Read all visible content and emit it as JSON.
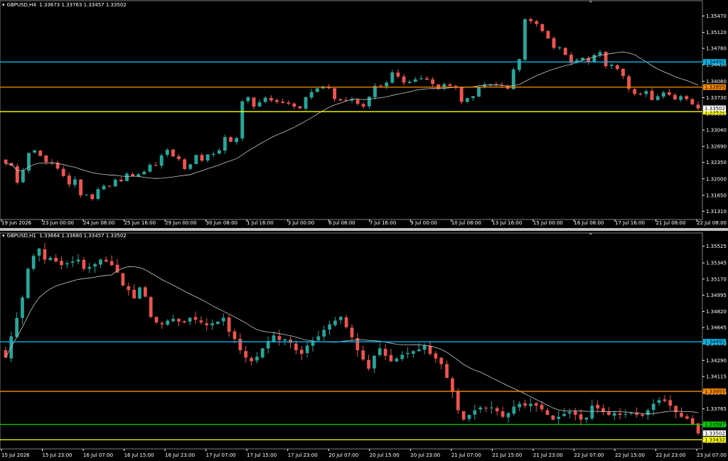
{
  "colors": {
    "background": "#000000",
    "up": "#26a69a",
    "down": "#ef5350",
    "ma": "#c8c8c8",
    "axis": "#ffffff",
    "level_cyan": "#00b7eb",
    "level_orange": "#ff8c00",
    "level_yellow": "#ffff00",
    "level_green": "#00d000"
  },
  "chart_data": [
    {
      "type": "candlestick",
      "title": "GBPUSD,H4  1.33673 1.33763 1.33457 1.33502",
      "symbol": "GBPUSD",
      "timeframe": "H4",
      "ohlc": {
        "open": "1.33673",
        "high": "1.33763",
        "low": "1.33457",
        "close": "1.33502"
      },
      "ylim": [
        1.3118,
        1.3575
      ],
      "y_ticks": [
        "1.35470",
        "1.35120",
        "1.34780",
        "1.34430",
        "1.34080",
        "1.33730",
        "1.33390",
        "1.33040",
        "1.32690",
        "1.32350",
        "1.32000",
        "1.31650",
        "1.31310"
      ],
      "x_ticks": [
        "19 Jun 2026",
        "23 Jun 00:00",
        "24 Jun 08:00",
        "25 Jun 16:00",
        "29 Jun 00:00",
        "30 Jun 08:00",
        "1 Jul 16:00",
        "3 Jul 00:00",
        "6 Jul 08:00",
        "7 Jul 16:00",
        "9 Jul 00:00",
        "10 Jul 08:00",
        "13 Jul 16:00",
        "15 Jul 00:00",
        "16 Jul 08:00",
        "17 Jul 16:00",
        "21 Jul 08:00",
        "22 Jul 08:00"
      ],
      "levels": [
        {
          "value": 1.34491,
          "label": "1.34491",
          "color": "#00b7eb"
        },
        {
          "value": 1.33955,
          "label": "1.33955",
          "color": "#ff8c00"
        },
        {
          "value": 1.33432,
          "label": "1.33432",
          "color": "#ffff00"
        }
      ],
      "price_tags": [
        {
          "value": 1.33502,
          "label": "1.33502",
          "color": "#ffffff"
        }
      ],
      "closes": [
        1.3233,
        1.3228,
        1.3192,
        1.3218,
        1.3255,
        1.3261,
        1.3249,
        1.3236,
        1.3235,
        1.3222,
        1.3206,
        1.3188,
        1.3199,
        1.3165,
        1.3166,
        1.3157,
        1.3178,
        1.3185,
        1.3185,
        1.3198,
        1.3195,
        1.3211,
        1.3206,
        1.321,
        1.3215,
        1.323,
        1.3228,
        1.325,
        1.3262,
        1.3248,
        1.3242,
        1.3221,
        1.3231,
        1.3251,
        1.3239,
        1.3252,
        1.3253,
        1.3261,
        1.3289,
        1.3279,
        1.3287,
        1.3365,
        1.3374,
        1.3354,
        1.3363,
        1.3373,
        1.3367,
        1.3364,
        1.3362,
        1.336,
        1.3354,
        1.335,
        1.3374,
        1.3385,
        1.3393,
        1.3397,
        1.3393,
        1.337,
        1.3367,
        1.3366,
        1.3369,
        1.336,
        1.3354,
        1.3375,
        1.3398,
        1.3398,
        1.3405,
        1.3427,
        1.3418,
        1.3405,
        1.3407,
        1.3412,
        1.3414,
        1.3411,
        1.3402,
        1.3393,
        1.3402,
        1.3398,
        1.3394,
        1.3364,
        1.3372,
        1.3376,
        1.3395,
        1.3401,
        1.3402,
        1.34,
        1.3398,
        1.3392,
        1.3433,
        1.3455,
        1.354,
        1.3536,
        1.353,
        1.3515,
        1.3499,
        1.3479,
        1.348,
        1.3464,
        1.3447,
        1.3453,
        1.3458,
        1.3448,
        1.3464,
        1.347,
        1.344,
        1.3443,
        1.3434,
        1.3419,
        1.3392,
        1.3381,
        1.338,
        1.3387,
        1.3368,
        1.3376,
        1.3384,
        1.3379,
        1.3369,
        1.3376,
        1.337,
        1.3359,
        1.335
      ],
      "ma_period": 20
    },
    {
      "type": "candlestick",
      "title": "GBPUSD,H1  1.33664 1.33680 1.33457 1.33502",
      "symbol": "GBPUSD",
      "timeframe": "H1",
      "ohlc": {
        "open": "1.33664",
        "high": "1.33680",
        "low": "1.33457",
        "close": "1.33502"
      },
      "ylim": [
        1.33355,
        1.35645
      ],
      "y_ticks": [
        "1.35525",
        "1.35345",
        "1.35170",
        "1.34995",
        "1.34820",
        "1.34645",
        "1.34470",
        "1.34290",
        "1.34115",
        "1.33940",
        "1.33765",
        "1.33590",
        "1.33415"
      ],
      "x_ticks": [
        "15 Jul 2026",
        "15 Jul 23:00",
        "16 Jul 07:00",
        "16 Jul 15:00",
        "16 Jul 23:00",
        "17 Jul 07:00",
        "17 Jul 15:00",
        "17 Jul 23:00",
        "20 Jul 07:00",
        "20 Jul 15:00",
        "20 Jul 23:00",
        "21 Jul 07:00",
        "21 Jul 15:00",
        "21 Jul 23:00",
        "22 Jul 07:00",
        "22 Jul 15:00",
        "22 Jul 23:00",
        "23 Jul 07:00"
      ],
      "levels": [
        {
          "value": 1.34491,
          "label": "1.34491",
          "color": "#00b7eb"
        },
        {
          "value": 1.33955,
          "label": "1.33955",
          "color": "#ff8c00"
        },
        {
          "value": 1.33597,
          "label": "1.33597",
          "color": "#00d000"
        },
        {
          "value": 1.33432,
          "label": "1.33432",
          "color": "#ffff00"
        }
      ],
      "price_tags": [
        {
          "value": 1.33502,
          "label": "1.33502",
          "color": "#ffffff"
        }
      ],
      "closes": [
        1.3432,
        1.3455,
        1.3475,
        1.3497,
        1.3528,
        1.3542,
        1.355,
        1.3538,
        1.354,
        1.3536,
        1.3532,
        1.3534,
        1.3536,
        1.3538,
        1.3528,
        1.353,
        1.3533,
        1.3538,
        1.3536,
        1.3532,
        1.3524,
        1.351,
        1.3505,
        1.3496,
        1.3508,
        1.3498,
        1.3476,
        1.347,
        1.3468,
        1.3472,
        1.3474,
        1.3471,
        1.347,
        1.3475,
        1.3473,
        1.347,
        1.3467,
        1.3469,
        1.3471,
        1.3475,
        1.346,
        1.3452,
        1.344,
        1.3432,
        1.3428,
        1.3433,
        1.3442,
        1.345,
        1.3456,
        1.3451,
        1.3452,
        1.3448,
        1.344,
        1.3436,
        1.3445,
        1.345,
        1.3455,
        1.3462,
        1.3468,
        1.3472,
        1.3476,
        1.3465,
        1.3454,
        1.344,
        1.343,
        1.342,
        1.3434,
        1.3442,
        1.3434,
        1.3428,
        1.3431,
        1.3435,
        1.3437,
        1.3439,
        1.3441,
        1.3445,
        1.3436,
        1.3431,
        1.3425,
        1.341,
        1.3395,
        1.3375,
        1.3365,
        1.337,
        1.3375,
        1.3378,
        1.3377,
        1.3378,
        1.3374,
        1.3368,
        1.3372,
        1.3379,
        1.3382,
        1.338,
        1.3382,
        1.338,
        1.3376,
        1.337,
        1.3365,
        1.3368,
        1.3371,
        1.3373,
        1.337,
        1.3365,
        1.3367,
        1.338,
        1.3377,
        1.3373,
        1.337,
        1.3372,
        1.337,
        1.3371,
        1.3372,
        1.337,
        1.3369,
        1.3375,
        1.3382,
        1.3386,
        1.3385,
        1.338,
        1.3373,
        1.3368,
        1.3366,
        1.336,
        1.335
      ],
      "ma_period": 20
    }
  ]
}
